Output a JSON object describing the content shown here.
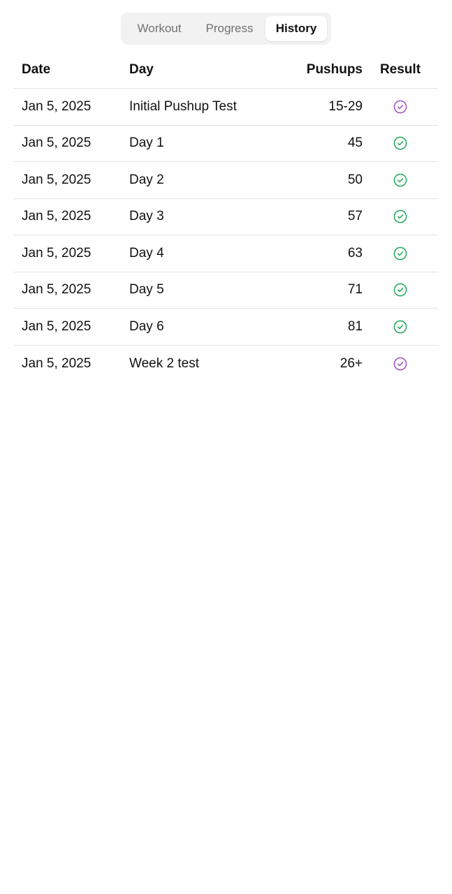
{
  "tabs": [
    {
      "label": "Workout",
      "active": false
    },
    {
      "label": "Progress",
      "active": false
    },
    {
      "label": "History",
      "active": true
    }
  ],
  "table": {
    "headers": {
      "date": "Date",
      "day": "Day",
      "pushups": "Pushups",
      "result": "Result"
    },
    "rows": [
      {
        "date": "Jan 5, 2025",
        "day": "Initial Pushup Test",
        "pushups": "15-29",
        "result_icon": "check-circle-icon",
        "color": "#a34fc9"
      },
      {
        "date": "Jan 5, 2025",
        "day": "Day 1",
        "pushups": "45",
        "result_icon": "check-circle-icon",
        "color": "#22a85a"
      },
      {
        "date": "Jan 5, 2025",
        "day": "Day 2",
        "pushups": "50",
        "result_icon": "check-circle-icon",
        "color": "#22a85a"
      },
      {
        "date": "Jan 5, 2025",
        "day": "Day 3",
        "pushups": "57",
        "result_icon": "check-circle-icon",
        "color": "#22a85a"
      },
      {
        "date": "Jan 5, 2025",
        "day": "Day 4",
        "pushups": "63",
        "result_icon": "check-circle-icon",
        "color": "#22a85a"
      },
      {
        "date": "Jan 5, 2025",
        "day": "Day 5",
        "pushups": "71",
        "result_icon": "check-circle-icon",
        "color": "#22a85a"
      },
      {
        "date": "Jan 5, 2025",
        "day": "Day 6",
        "pushups": "81",
        "result_icon": "check-circle-icon",
        "color": "#22a85a"
      },
      {
        "date": "Jan 5, 2025",
        "day": "Week 2 test",
        "pushups": "26+",
        "result_icon": "check-circle-icon",
        "color": "#a34fc9"
      }
    ]
  }
}
